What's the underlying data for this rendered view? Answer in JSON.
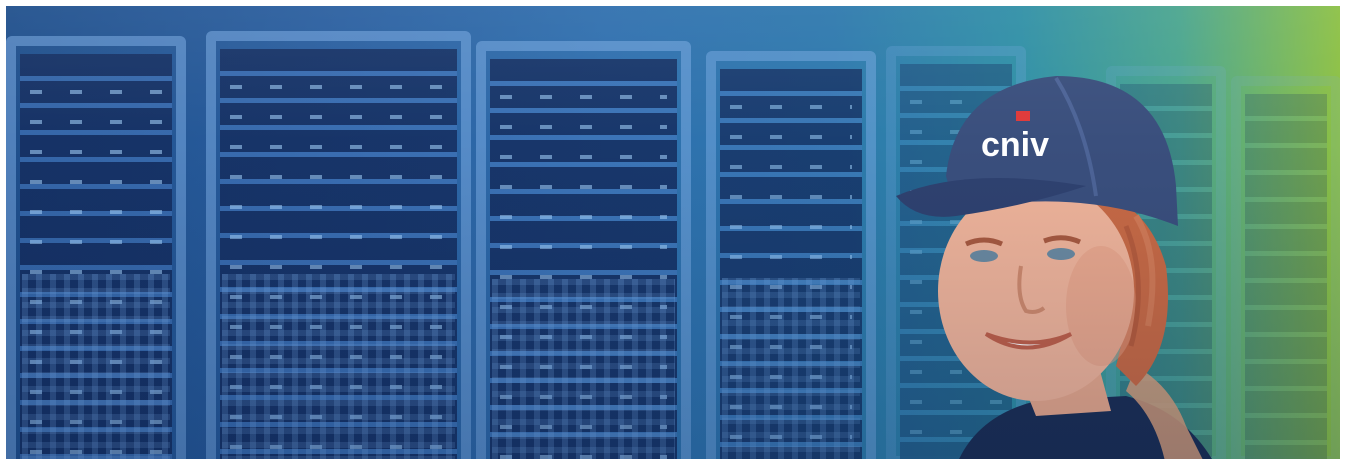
{
  "image": {
    "description_tag": "banner-photo",
    "colors": {
      "bg_left": "#1f4f8c",
      "bg_right": "#8cc044",
      "cap": "#3a4f7d",
      "cap_logo_red": "#e03a3a",
      "skin": "#f0b49a",
      "hair": "#c86a45",
      "shirt": "#1c2f55"
    },
    "cap_text": "cniv"
  }
}
